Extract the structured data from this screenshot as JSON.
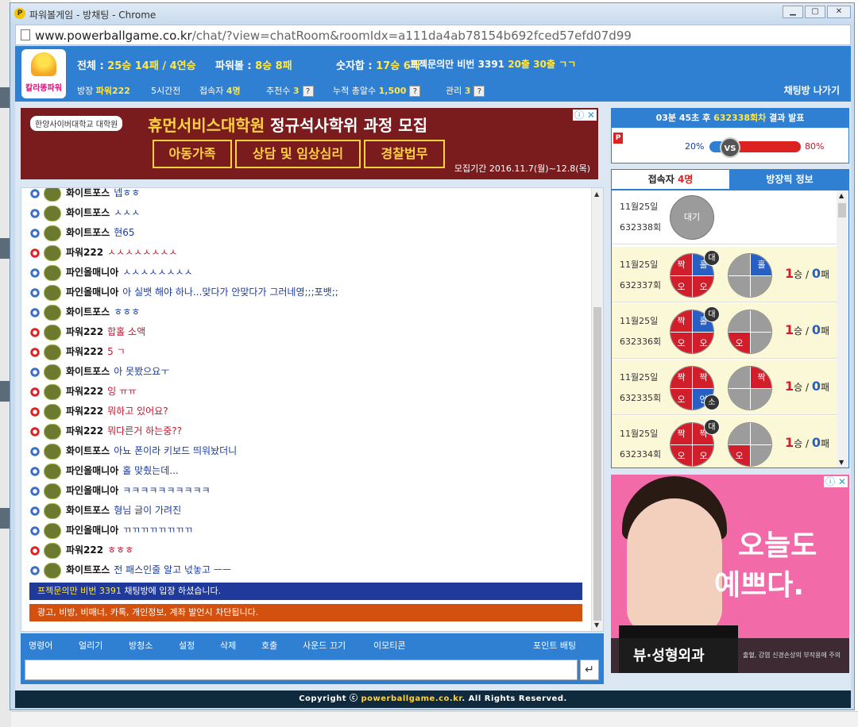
{
  "window": {
    "title": "파워볼게임 - 방채팅 - Chrome",
    "address": "www.powerballgame.co.kr",
    "address_path": "/chat/?view=chatRoom&roomIdx=a111da4ab78154b692fced57efd07d99"
  },
  "logo": {
    "text": "칼라똥파워"
  },
  "header": {
    "stats": [
      {
        "label": "전체 : ",
        "value": "25승 14패 / 4연승"
      },
      {
        "label": "파워볼 : ",
        "value": "8승 8패"
      },
      {
        "label": "숫자합 : ",
        "value": "17승 6패"
      },
      {
        "label": "프젝문의만 비번 3391",
        "value": "20출 30출 ㄱㄱ"
      }
    ],
    "sub": {
      "owner_label": "방장",
      "owner": "파워222",
      "time": "5시간전",
      "users_label": "접속자",
      "users": "4명",
      "recommend_label": "추천수",
      "recommend": "3",
      "total_label": "누적 총알수",
      "total": "1,500",
      "manage_label": "관리",
      "manage": "3"
    },
    "leave": "채팅방 나가기"
  },
  "ad_top": {
    "uni": "한양사이버대학교 대학원",
    "headline_a": "휴먼서비스대학원",
    "headline_b": " 정규석사학위 과정 모집",
    "tags": [
      "아동가족",
      "상담 및 임상심리",
      "경찰법무"
    ],
    "period": "모집기간 2016.11.7(월)~12.8(목)",
    "adx": "ⓘ ✕"
  },
  "messages": [
    {
      "user": "화이트포스",
      "text": "넵ㅎㅎ",
      "team": "blue"
    },
    {
      "user": "화이트포스",
      "text": "ㅅㅅㅅ",
      "team": "blue"
    },
    {
      "user": "화이트포스",
      "text": "현65",
      "team": "blue"
    },
    {
      "user": "파워222",
      "text": "ㅅㅅㅅㅅㅅㅅㅅㅅ",
      "team": "red"
    },
    {
      "user": "파인올매니아",
      "text": "ㅅㅅㅅㅅㅅㅅㅅㅅ",
      "team": "blue"
    },
    {
      "user": "파인올매니아",
      "text": "아 실뱃 해야 하나...맞다가 안맞다가 그러네영;;;포뱃;;",
      "team": "blue"
    },
    {
      "user": "화이트포스",
      "text": "ㅎㅎㅎ",
      "team": "blue"
    },
    {
      "user": "파워222",
      "text": "합홀 소액",
      "team": "red"
    },
    {
      "user": "파워222",
      "text": "5 ㄱ",
      "team": "red"
    },
    {
      "user": "화이트포스",
      "text": "아 못봤으요ㅜ",
      "team": "blue"
    },
    {
      "user": "파워222",
      "text": "잉 ㅠㅠ",
      "team": "red"
    },
    {
      "user": "파워222",
      "text": "뭐하고 있어요?",
      "team": "red"
    },
    {
      "user": "파워222",
      "text": "뭐다른거 하는중??",
      "team": "red"
    },
    {
      "user": "화이트포스",
      "text": "아뇨 폰이라 키보드 띄워놨더니",
      "team": "blue"
    },
    {
      "user": "파인올매니아",
      "text": "홀 맞췄는데...",
      "team": "blue"
    },
    {
      "user": "파인올매니아",
      "text": "ㅋㅋㅋㅋㅋㅋㅋㅋㅋㅋ",
      "team": "blue"
    },
    {
      "user": "화이트포스",
      "text": "형님 글이 가려진",
      "team": "blue"
    },
    {
      "user": "파인올매니아",
      "text": "ㄲㄲㄲㄲㄲㄲㄲㄲ",
      "team": "blue"
    },
    {
      "user": "파워222",
      "text": "ㅎㅎㅎ",
      "team": "red"
    },
    {
      "user": "화이트포스",
      "text": "전 패스인줄 알고 넋놓고 ㅡㅡ",
      "team": "blue"
    }
  ],
  "notices": {
    "n1_hi": "프젝문의만 비번 3391",
    "n1": " 채팅방에 입장 하셨습니다.",
    "n2": "광고, 비방, 비매너, 카톡, 개인정보, 계좌 발언시 차단됩니다."
  },
  "toolbar": {
    "items": [
      "명령어",
      "얼리기",
      "방청소",
      "설정",
      "삭제",
      "호출",
      "사운드 끄기",
      "이모티콘"
    ],
    "point": "포인트 배팅"
  },
  "send": "↵",
  "footer": {
    "pre": "Copyright ⓒ ",
    "site": "powerballgame.co.kr",
    "post": ". All Rights Reserved."
  },
  "result": {
    "header_a": "03분 45초 후 ",
    "header_b": "632338회차",
    "header_c": " 결과 발표",
    "p": "P",
    "pct_left": "20%",
    "pct_right": "80%",
    "vs": "VS",
    "left_fraction": 0.2,
    "right_fraction": 0.8
  },
  "tabs": {
    "users_label": "접속자 ",
    "users": "4명",
    "info": "방장픽 정보"
  },
  "rounds": [
    {
      "date": "11월25일",
      "no": "632338회",
      "wait": "대기"
    },
    {
      "date": "11월25일",
      "no": "632337회",
      "a": [
        "짝",
        "홀",
        "오",
        "오"
      ],
      "ac": [
        "R",
        "B",
        "R",
        "R"
      ],
      "abadge": "대",
      "b": [
        "",
        "홀",
        "",
        ""
      ],
      "bc": [
        "G",
        "B",
        "G",
        "G"
      ],
      "w": "1",
      "wl": "승 / ",
      "l": "0",
      "ll": "패"
    },
    {
      "date": "11월25일",
      "no": "632336회",
      "a": [
        "짝",
        "홀",
        "오",
        "오"
      ],
      "ac": [
        "R",
        "B",
        "R",
        "R"
      ],
      "abadge": "대",
      "b": [
        "",
        "",
        "오",
        ""
      ],
      "bc": [
        "G",
        "G",
        "R",
        "G"
      ],
      "w": "1",
      "wl": "승 / ",
      "l": "0",
      "ll": "패"
    },
    {
      "date": "11월25일",
      "no": "632335회",
      "a": [
        "짝",
        "짝",
        "오",
        "언"
      ],
      "ac": [
        "R",
        "R",
        "R",
        "B"
      ],
      "abadge": "소",
      "b": [
        "",
        "짝",
        "",
        ""
      ],
      "bc": [
        "G",
        "R",
        "G",
        "G"
      ],
      "w": "1",
      "wl": "승 / ",
      "l": "0",
      "ll": "패"
    },
    {
      "date": "11월25일",
      "no": "632334회",
      "a": [
        "짝",
        "짝",
        "오",
        "오"
      ],
      "ac": [
        "R",
        "R",
        "R",
        "R"
      ],
      "abadge": "대",
      "b": [
        "",
        "",
        "오",
        ""
      ],
      "bc": [
        "G",
        "G",
        "R",
        "G"
      ],
      "w": "1",
      "wl": "승 / ",
      "l": "0",
      "ll": "패"
    }
  ],
  "ad_right": {
    "t1": "오늘도",
    "t2": "예쁘다.",
    "brand": "뷰·성형외과",
    "small": "출혈, 감염 신경손상의 부작용에 주의",
    "adx": "ⓘ ✕"
  },
  "colors": {
    "header_blue": "#2f7fd3",
    "red": "#d21e2b",
    "blue": "#2760c2"
  }
}
